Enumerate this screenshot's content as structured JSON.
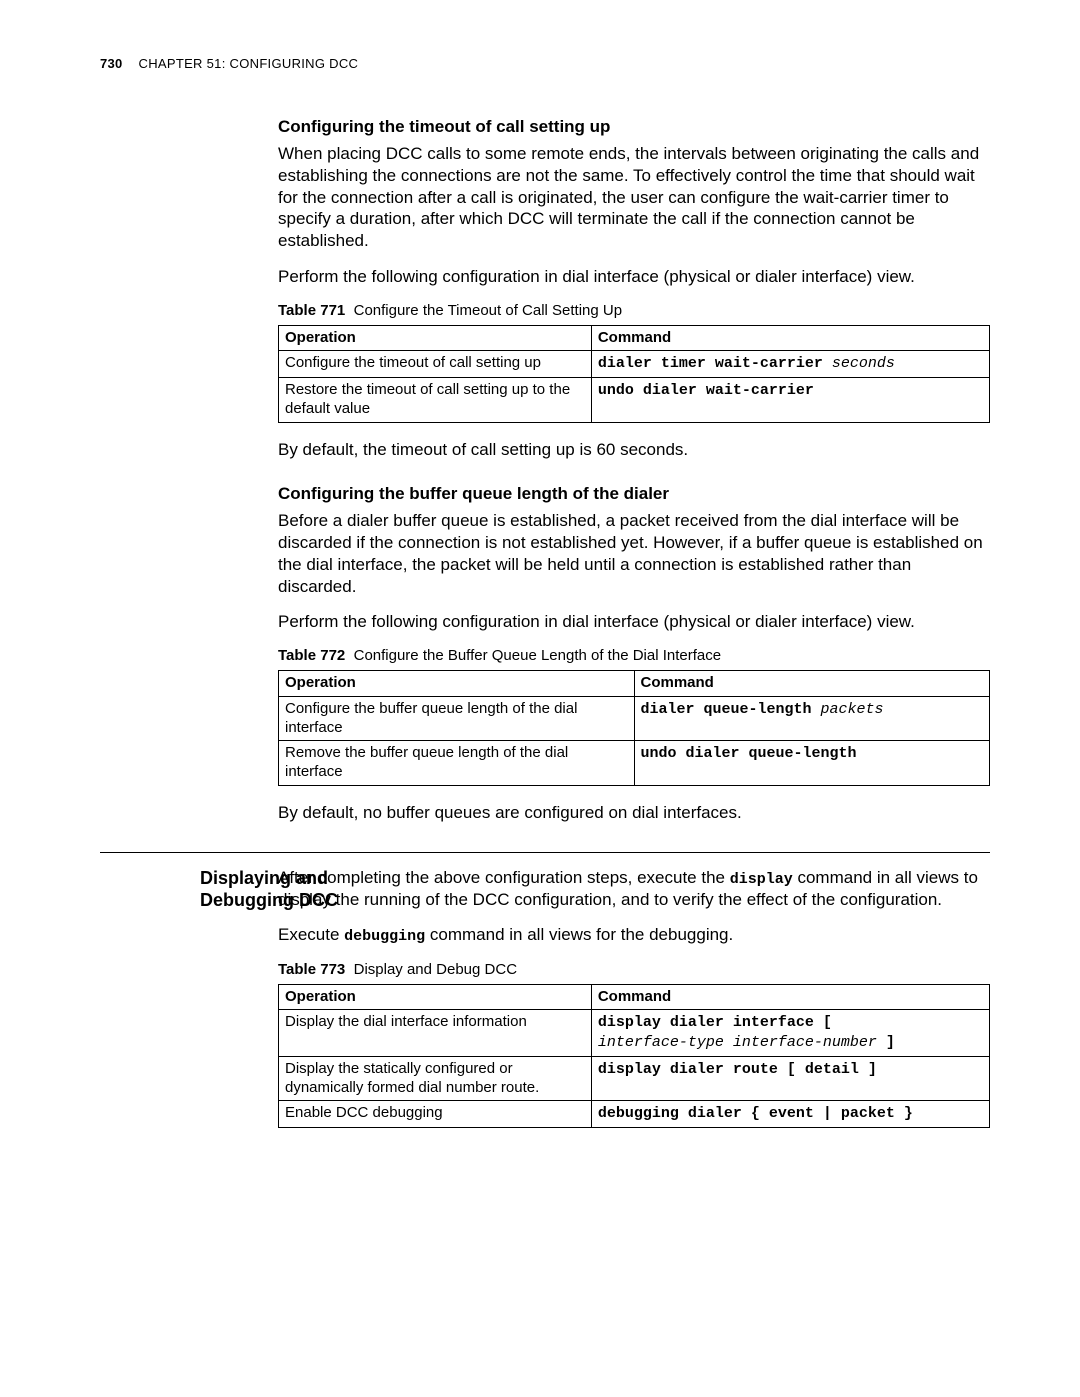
{
  "page_number": "730",
  "running_head": "CHAPTER 51: CONFIGURING DCC",
  "sec1_title": "Configuring the timeout of call setting up",
  "sec1_p1": "When placing DCC calls to some remote ends, the intervals between originating the calls and establishing the connections are not the same. To effectively control the time that should wait for the connection after a call is originated, the user can configure the wait-carrier timer to specify a duration, after which DCC will terminate the call if the connection cannot be established.",
  "sec1_p2": "Perform the following configuration in dial interface (physical or dialer interface) view.",
  "tbl1_label": "Table 771",
  "tbl1_caption": "Configure the Timeout of Call Setting Up",
  "th_op": "Operation",
  "th_cmd": "Command",
  "t1_r1_op": "Configure the timeout of call setting up",
  "t1_r1_cmd_a": "dialer timer wait-carrier ",
  "t1_r1_cmd_b": "seconds",
  "t1_r2_op": "Restore the timeout of call setting up to the default value",
  "t1_r2_cmd": "undo dialer wait-carrier",
  "sec1_p3": "By default, the timeout of call setting up is 60 seconds.",
  "sec2_title": "Configuring the buffer queue length of the dialer",
  "sec2_p1": "Before a dialer buffer queue is established, a packet received from the dial interface will be discarded if the connection is not established yet. However, if a buffer queue is established on the dial interface, the packet will be held until a connection is established rather than discarded.",
  "sec2_p2": "Perform the following configuration in dial interface (physical or dialer interface) view.",
  "tbl2_label": "Table 772",
  "tbl2_caption": "Configure the Buffer Queue Length of the Dial Interface",
  "t2_r1_op": "Configure the buffer queue length of the dial interface",
  "t2_r1_cmd_a": "dialer queue-length ",
  "t2_r1_cmd_b": "packets",
  "t2_r2_op": "Remove the buffer queue length of the dial interface",
  "t2_r2_cmd": "undo dialer queue-length",
  "sec2_p3": "By default, no buffer queues are configured on dial interfaces.",
  "sidehead": "Displaying and Debugging DCC",
  "sec3_p1a": "After completing the above configuration steps, execute the ",
  "sec3_p1b": "display",
  "sec3_p1c": " command in all views to display the running of the DCC configuration, and to verify the effect of the configuration.",
  "sec3_p2a": "Execute ",
  "sec3_p2b": "debugging",
  "sec3_p2c": " command in all views for the debugging.",
  "tbl3_label": "Table 773",
  "tbl3_caption": "Display and Debug DCC",
  "t3_r1_op": "Display the dial interface information",
  "t3_r1_cmd_a": "display dialer interface [ ",
  "t3_r1_cmd_b": "interface-type interface-number",
  "t3_r1_cmd_c": " ]",
  "t3_r2_op": "Display the statically configured or dynamically formed dial number route.",
  "t3_r2_cmd": "display dialer route [ detail ]",
  "t3_r3_op": "Enable DCC debugging",
  "t3_r3_cmd": "debugging dialer { event | packet }"
}
